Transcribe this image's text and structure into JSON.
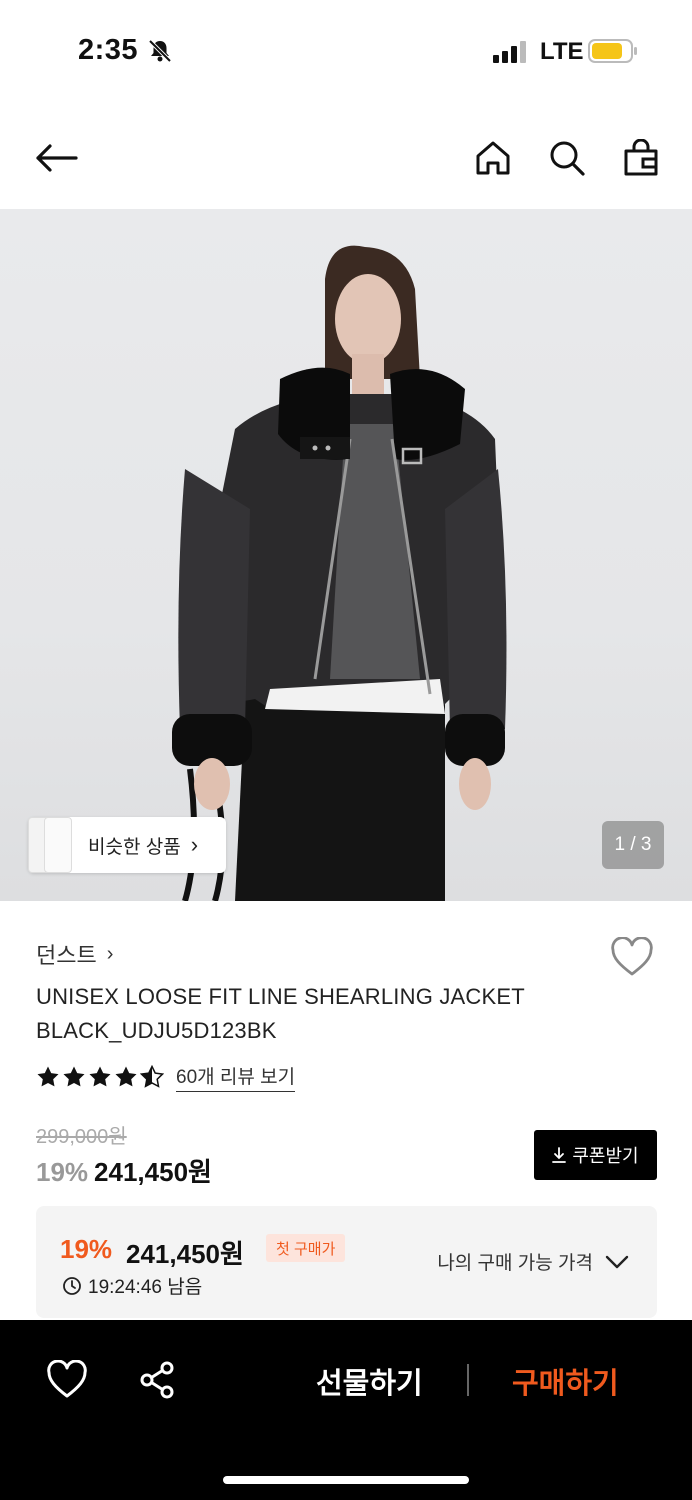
{
  "status_bar": {
    "time": "2:35",
    "network": "LTE",
    "battery_color": "#f5c518"
  },
  "nav": {
    "back_icon": "back-arrow-icon",
    "home_icon": "home-icon",
    "search_icon": "search-icon",
    "cart_icon": "shopping-bag-icon"
  },
  "gallery": {
    "similar_label": "비슷한 상품",
    "similar_chevron": "›",
    "page_indicator": "1 / 3"
  },
  "product": {
    "brand": "던스트",
    "brand_chevron": "›",
    "title": "UNISEX LOOSE FIT LINE SHEARLING JACKET BLACK_UDJU5D123BK",
    "rating": 4.5,
    "review_link": "60개 리뷰 보기",
    "original_price": "299,000원",
    "discount": "19%",
    "price": "241,450원",
    "coupon_label": "쿠폰받기"
  },
  "best_price": {
    "discount": "19%",
    "price": "241,450원",
    "badge": "첫 구매가",
    "timer": "19:24:46 남음",
    "my_price_label": "나의 구매 가능 가격"
  },
  "bottom_bar": {
    "gift_label": "선물하기",
    "buy_label": "구매하기",
    "accent_color": "#f05a1e"
  }
}
